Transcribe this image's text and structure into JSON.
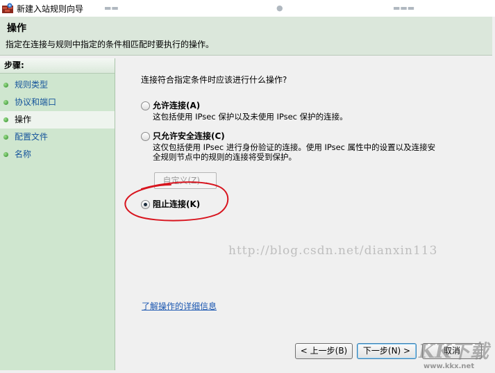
{
  "window": {
    "title": "新建入站规则向导"
  },
  "header": {
    "title": "操作",
    "subtitle": "指定在连接与规则中指定的条件相匹配时要执行的操作。"
  },
  "sidebar": {
    "heading": "步骤:",
    "items": [
      {
        "label": "规则类型",
        "active": false
      },
      {
        "label": "协议和端口",
        "active": false
      },
      {
        "label": "操作",
        "active": true
      },
      {
        "label": "配置文件",
        "active": false
      },
      {
        "label": "名称",
        "active": false
      }
    ]
  },
  "main": {
    "question": "连接符合指定条件时应该进行什么操作?",
    "options": [
      {
        "label": "允许连接(A)",
        "desc_lines": [
          "这包括使用 IPsec 保护以及未使用 IPsec 保护的连接。"
        ],
        "selected": false
      },
      {
        "label": "只允许安全连接(C)",
        "desc_lines": [
          "这仅包括使用 IPsec 进行身份验证的连接。使用 IPsec 属性中的设置以及连接安",
          "全规则节点中的规则的连接将受到保护。"
        ],
        "selected": false
      },
      {
        "label": "阻止连接(K)",
        "desc_lines": [],
        "selected": true
      }
    ],
    "customize_label": "自定义(Z)...",
    "learn_more_link": "了解操作的详细信息"
  },
  "watermark": "http://blog.csdn.net/dianxin113",
  "buttons": {
    "back": "< 上一步(B)",
    "next": "下一步(N) >",
    "cancel": "取消"
  },
  "corner_brand": {
    "logo": "KK下载",
    "url": "www.kkx.net"
  },
  "colors": {
    "header_bg": "#dbe7db",
    "sidebar_bg": "#cfe6cf",
    "link": "#1a56b0",
    "annotation": "#d8141e"
  }
}
